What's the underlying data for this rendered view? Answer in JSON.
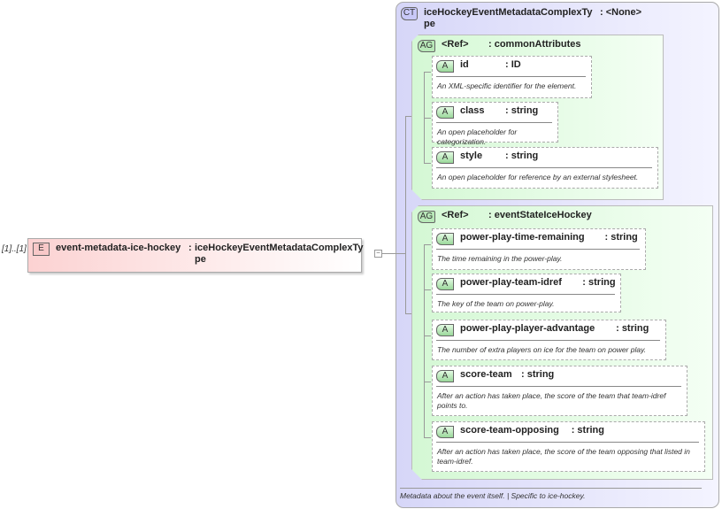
{
  "element": {
    "cardinality": "[1]..[1]",
    "badge": "E",
    "name": "event-metadata-ice-hockey",
    "sep": ":",
    "type_line1": "iceHockeyEventMetadataComplexTy",
    "type_line2": "pe",
    "toggle": "−"
  },
  "complex_type": {
    "badge": "CT",
    "name_line1": "iceHockeyEventMetadataComplexTy",
    "name_line2": "pe",
    "base": ": <None>",
    "documentation": "Metadata about the event itself. | Specific to ice-hockey."
  },
  "attribute_groups": [
    {
      "badge": "AG",
      "ref": "<Ref>",
      "name": ": commonAttributes",
      "attributes": [
        {
          "name": "id",
          "type": ": ID",
          "doc": "An XML-specific identifier for the element."
        },
        {
          "name": "class",
          "type": ": string",
          "doc": "An open placeholder for categorization."
        },
        {
          "name": "style",
          "type": ": string",
          "doc": "An open placeholder for reference by an external stylesheet."
        }
      ]
    },
    {
      "badge": "AG",
      "ref": "<Ref>",
      "name": ": eventStateIceHockey",
      "attributes": [
        {
          "name": "power-play-time-remaining",
          "type": ": string",
          "doc": "The time remaining in the power-play."
        },
        {
          "name": "power-play-team-idref",
          "type": ": string",
          "doc": "The key of the team on power-play."
        },
        {
          "name": "power-play-player-advantage",
          "type": ": string",
          "doc": "The number of extra players on ice for the team on power play."
        },
        {
          "name": "score-team",
          "type": ": string",
          "doc": "After an action has taken place, the score of the team that team-idref points to."
        },
        {
          "name": "score-team-opposing",
          "type": ": string",
          "doc": "After an action has taken place, the score of the team opposing that listed in team-idref."
        }
      ]
    }
  ],
  "attribute_badge": "A"
}
